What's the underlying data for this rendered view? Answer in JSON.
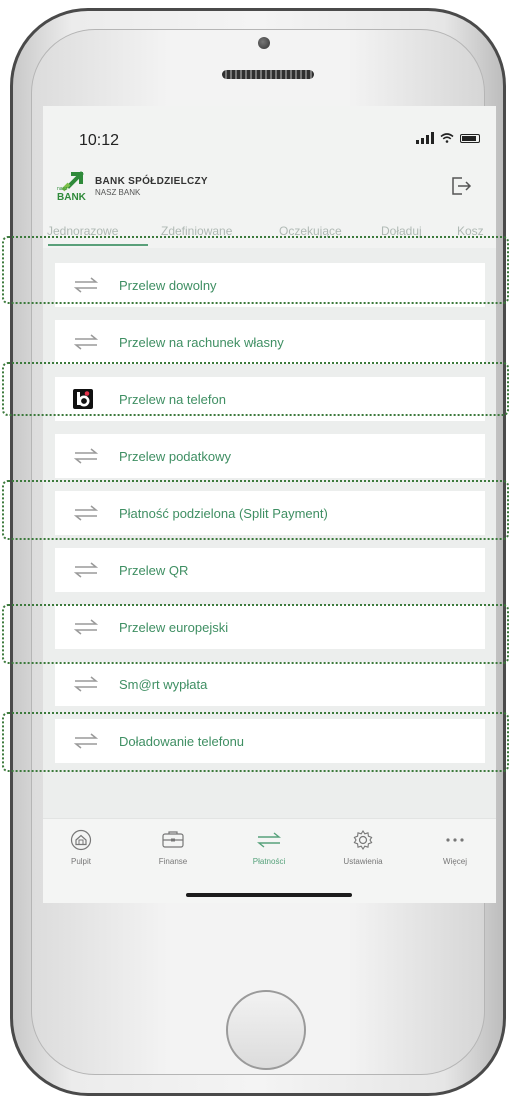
{
  "status": {
    "time": "10:12"
  },
  "bank": {
    "name": "BANK SPÓŁDZIELCZY",
    "subtitle": "NASZ BANK",
    "logo_small": "nasz",
    "logo_text": "BANK"
  },
  "tabs": [
    {
      "label": "Jednorazowe",
      "active": true
    },
    {
      "label": "Zdefiniowane",
      "active": false
    },
    {
      "label": "Oczekujące",
      "active": false
    },
    {
      "label": "Doładuj",
      "active": false
    },
    {
      "label": "Kosz",
      "active": false
    }
  ],
  "transfers": [
    {
      "label": "Przelew dowolny",
      "icon": "transfer-arrows-icon"
    },
    {
      "label": "Przelew na rachunek własny",
      "icon": "transfer-arrows-icon"
    },
    {
      "label": "Przelew na telefon",
      "icon": "blik-icon"
    },
    {
      "label": "Przelew podatkowy",
      "icon": "transfer-arrows-icon"
    },
    {
      "label": "Płatność podzielona (Split Payment)",
      "icon": "transfer-arrows-icon"
    },
    {
      "label": "Przelew QR",
      "icon": "transfer-arrows-icon"
    },
    {
      "label": "Przelew europejski",
      "icon": "transfer-arrows-icon"
    },
    {
      "label": "Sm@rt wypłata",
      "icon": "transfer-arrows-icon"
    },
    {
      "label": "Doładowanie telefonu",
      "icon": "transfer-arrows-icon"
    }
  ],
  "tabbar": [
    {
      "label": "Pulpit",
      "icon": "home-icon"
    },
    {
      "label": "Finanse",
      "icon": "wallet-icon"
    },
    {
      "label": "Płatności",
      "icon": "transfer-arrows-icon",
      "active": true
    },
    {
      "label": "Ustawienia",
      "icon": "gear-icon"
    },
    {
      "label": "Więcej",
      "icon": "more-dots-icon"
    }
  ],
  "colors": {
    "accent": "#56a27b",
    "highlight": "#3c7a3c"
  }
}
